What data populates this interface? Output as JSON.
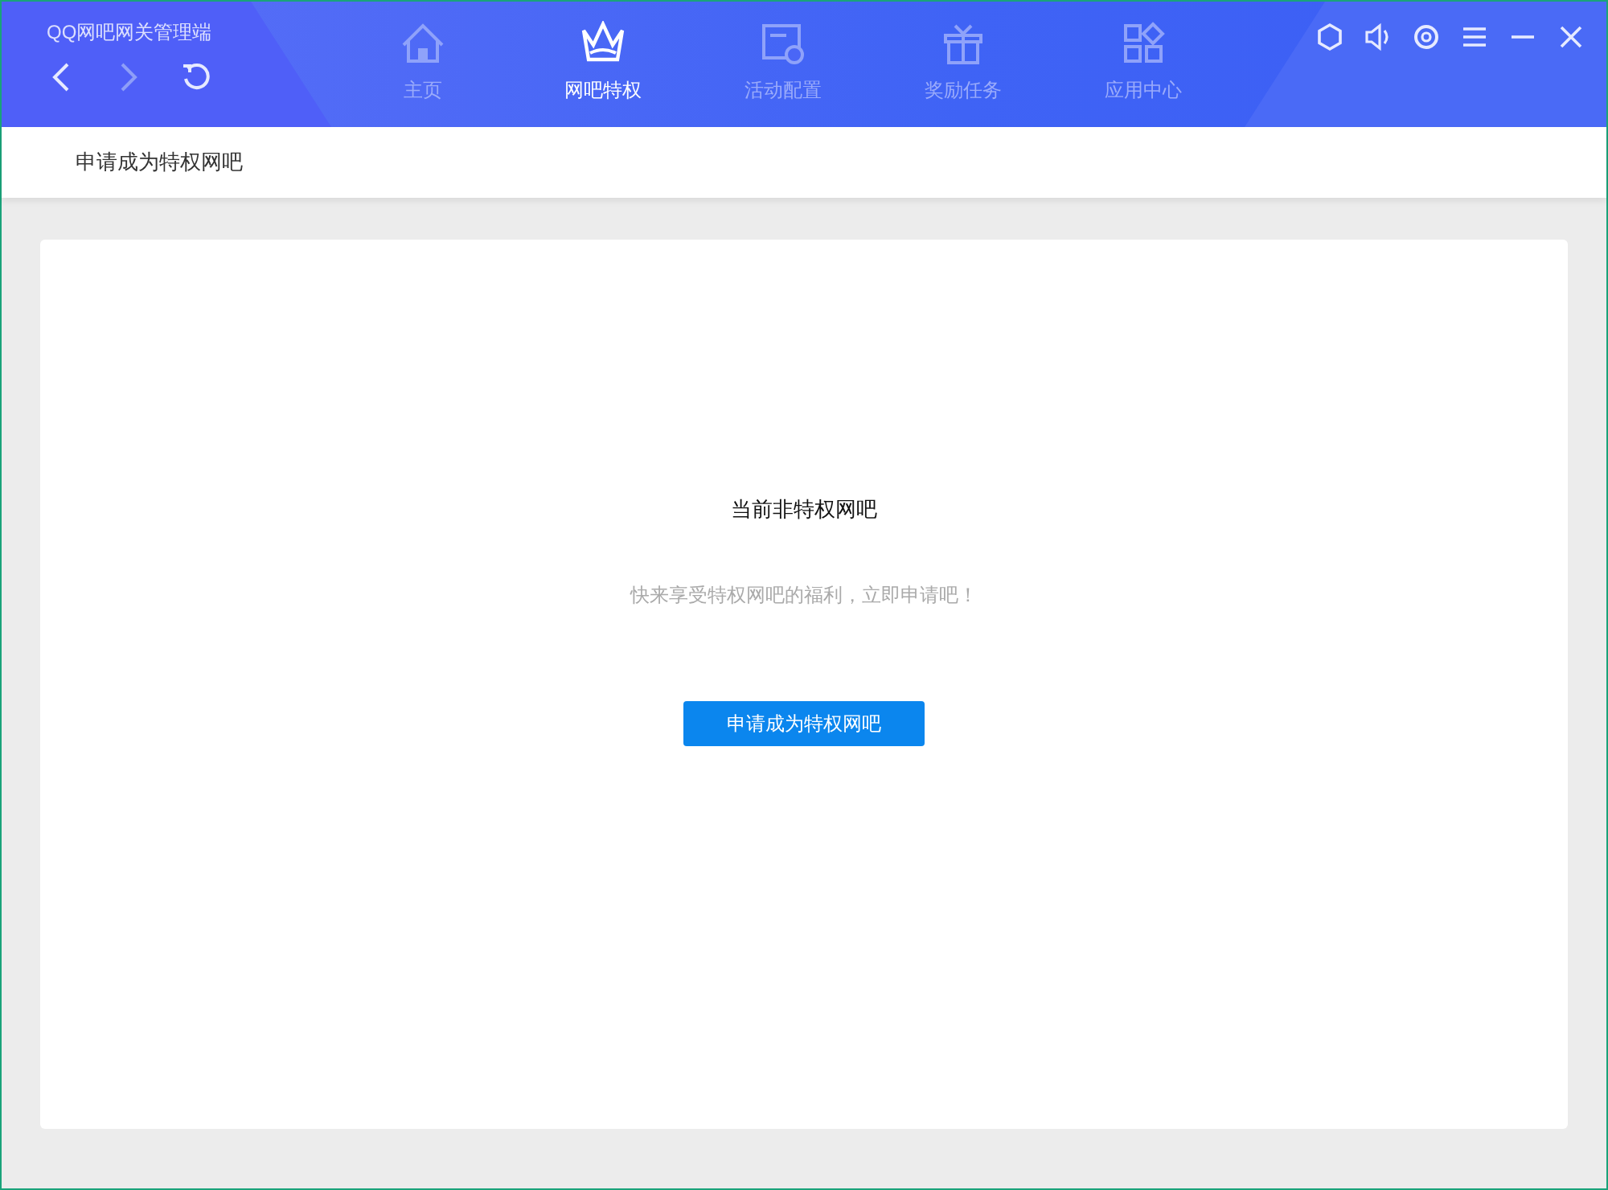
{
  "window": {
    "title": "QQ网吧网关管理端"
  },
  "nav": [
    {
      "kind": "home",
      "label": "主页",
      "selected": false
    },
    {
      "kind": "crown",
      "label": "网吧特权",
      "selected": true
    },
    {
      "kind": "activity",
      "label": "活动配置",
      "selected": false
    },
    {
      "kind": "gift",
      "label": "奖励任务",
      "selected": false
    },
    {
      "kind": "apps",
      "label": "应用中心",
      "selected": false
    }
  ],
  "window_controls": [
    {
      "kind": "hexagon"
    },
    {
      "kind": "speaker"
    },
    {
      "kind": "settings"
    },
    {
      "kind": "menu"
    },
    {
      "kind": "minimize"
    },
    {
      "kind": "close"
    }
  ],
  "breadcrumb": "申请成为特权网吧",
  "status": {
    "title": "当前非特权网吧",
    "message": "快来享受特权网吧的福利，立即申请吧！",
    "button": "申请成为特权网吧"
  }
}
